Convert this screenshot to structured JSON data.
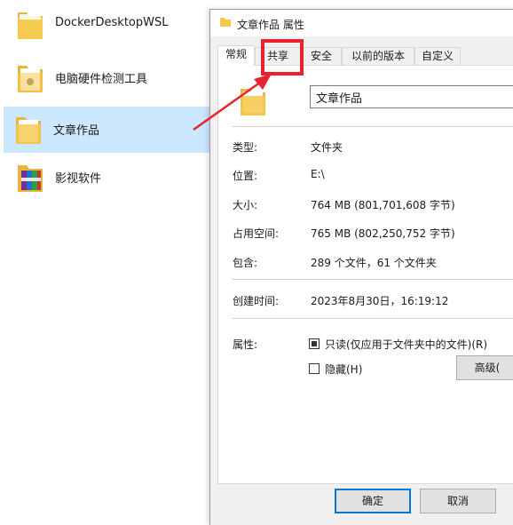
{
  "explorer": {
    "items": [
      {
        "label": "DockerDesktopWSL",
        "icon": "folder-icon"
      },
      {
        "label": "电脑硬件检测工具",
        "icon": "folder-icon"
      },
      {
        "label": "文章作品",
        "icon": "folder-icon",
        "selected": true
      },
      {
        "label": "影视软件",
        "icon": "archive-folder-icon"
      }
    ]
  },
  "dialog": {
    "title": "文章作品 属性",
    "tabs": [
      "常规",
      "共享",
      "安全",
      "以前的版本",
      "自定义"
    ],
    "active_tab": "常规",
    "highlighted_tab": "共享",
    "name_value": "文章作品",
    "properties": [
      {
        "label": "类型:",
        "value": "文件夹"
      },
      {
        "label": "位置:",
        "value": "E:\\"
      },
      {
        "label": "大小:",
        "value": "764 MB (801,701,608 字节)"
      },
      {
        "label": "占用空间:",
        "value": "765 MB (802,250,752 字节)"
      },
      {
        "label": "包含:",
        "value": "289 个文件，61 个文件夹"
      }
    ],
    "created_label": "创建时间:",
    "created_value": "2023年8月30日，16:19:12",
    "attributes_label": "属性:",
    "readonly_label": "只读(仅应用于文件夹中的文件)(R)",
    "hidden_label": "隐藏(H)",
    "advanced_button": "高级(",
    "ok_button": "确定",
    "cancel_button": "取消"
  },
  "colors": {
    "selection": "#cce8ff",
    "highlight_red": "#e8232d",
    "accent_blue": "#0078d7",
    "folder_yellow": "#f7c948"
  }
}
